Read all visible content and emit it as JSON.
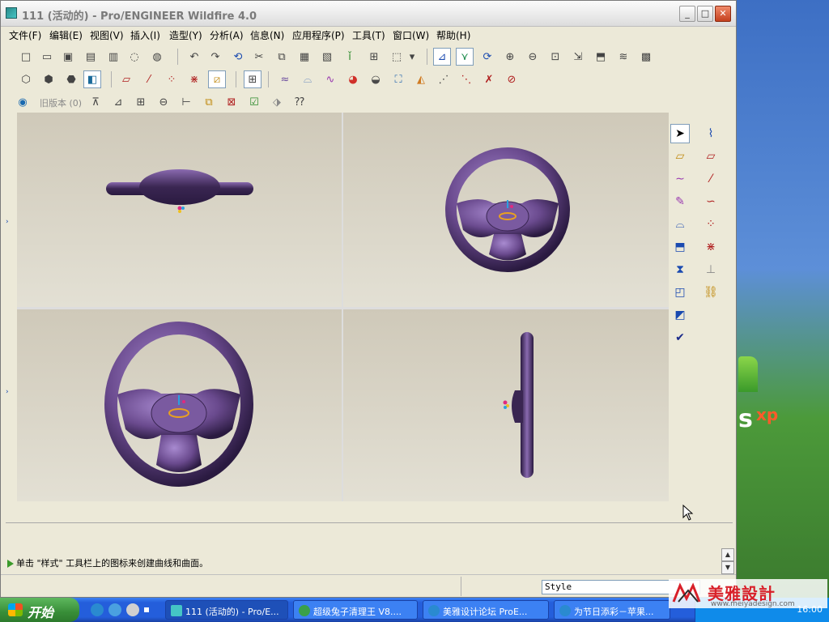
{
  "window": {
    "title": "111 (活动的) - Pro/ENGINEER Wildfire 4.0",
    "min_label": "_",
    "max_label": "□",
    "close_label": "✕"
  },
  "menu": [
    "文件(F)",
    "编辑(E)",
    "视图(V)",
    "插入(I)",
    "造型(Y)",
    "分析(A)",
    "信息(N)",
    "应用程序(P)",
    "工具(T)",
    "窗口(W)",
    "帮助(H)"
  ],
  "toolbar3": {
    "legacy_label": "旧版本 (0)"
  },
  "viewports": [
    {
      "name": "top-view"
    },
    {
      "name": "front-view"
    },
    {
      "name": "iso-view"
    },
    {
      "name": "right-view"
    }
  ],
  "colors": {
    "wheel": "#6a4a8e",
    "wheel_dark": "#3a2652",
    "wheel_light": "#9a7ac0",
    "logo": "#e8a020"
  },
  "message": {
    "text": "单击 \"样式\" 工具栏上的图标来创建曲线和曲面。"
  },
  "status": {
    "style_value": "Style"
  },
  "taskbar": {
    "start_label": "开始",
    "tasks": [
      {
        "label": "111 (活动的) - Pro/E..."
      },
      {
        "label": "超级兔子清理王 V8...."
      },
      {
        "label": "美雅设计论坛 ProE..."
      },
      {
        "label": "为节日添彩－苹果..."
      }
    ],
    "time": "16:00"
  },
  "watermark": {
    "text": "美雅設計",
    "url": "www.meiyadesign.com"
  }
}
